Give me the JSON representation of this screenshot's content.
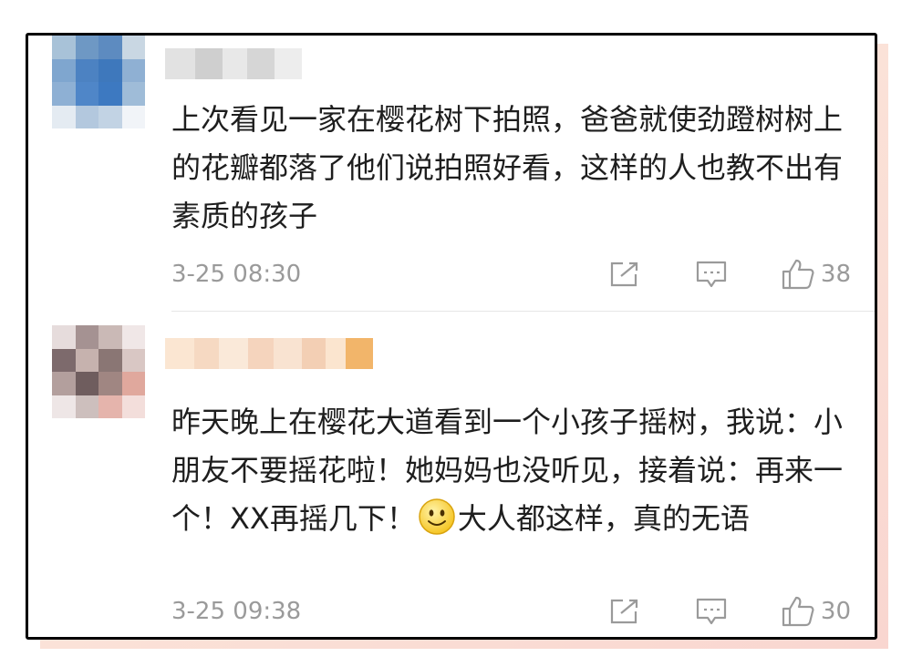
{
  "colors": {
    "frame": "#000000",
    "shadow": "#fbe3d8",
    "text": "#1e1e1e",
    "meta": "#9a9a9a"
  },
  "comments": [
    {
      "avatar_icon": "pixelated-avatar-icon",
      "username": "",
      "text": "上次看见一家在樱花树下拍照，爸爸就使劲蹬树树上的花瓣都落了他们说拍照好看，这样的人也教不出有素质的孩子",
      "time": "3-25 08:30",
      "likes": "38"
    },
    {
      "avatar_icon": "pixelated-avatar-icon",
      "username": "",
      "text_before_emoji": "昨天晚上在樱花大道看到一个小孩子摇树，我说：小朋友不要摇花啦！她妈妈也没听见，接着说：再来一个！XX再摇几下！",
      "emoji": "smile-emoji-icon",
      "text_after_emoji": "大人都这样，真的无语",
      "time": "3-25 09:38",
      "likes": "30"
    }
  ]
}
